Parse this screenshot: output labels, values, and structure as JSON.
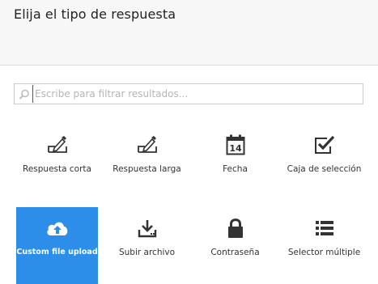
{
  "dialog": {
    "title": "Elija el tipo de respuesta"
  },
  "search": {
    "icon": "search-icon",
    "placeholder": "Escribe para filtrar resultados..."
  },
  "colors": {
    "selected_tile": "#2c8ee8",
    "header_bg": "#f7f7f7"
  },
  "response_types": [
    {
      "label": "Respuesta corta",
      "icon": "pencil-edit-icon",
      "selected": false
    },
    {
      "label": "Respuesta larga",
      "icon": "pencil-edit-icon",
      "selected": false
    },
    {
      "label": "Fecha",
      "icon": "calendar-icon",
      "day": "14",
      "selected": false
    },
    {
      "label": "Caja de selección",
      "icon": "checkbox-icon",
      "selected": false
    },
    {
      "label": "Custom file upload",
      "icon": "cloud-upload-icon",
      "selected": true
    },
    {
      "label": "Subir archivo",
      "icon": "download-tray-icon",
      "selected": false
    },
    {
      "label": "Contraseña",
      "icon": "lock-icon",
      "selected": false
    },
    {
      "label": "Selector múltiple",
      "icon": "list-icon",
      "selected": false
    }
  ]
}
